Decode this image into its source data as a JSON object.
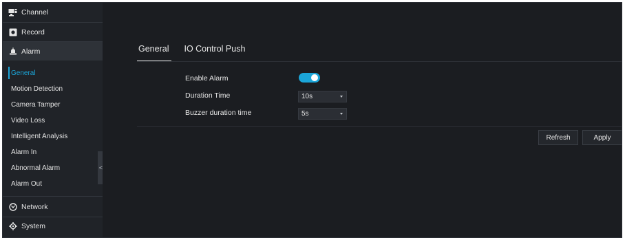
{
  "sidebar": {
    "top_items": [
      {
        "label": "Channel",
        "icon": "channel-icon"
      },
      {
        "label": "Record",
        "icon": "record-icon"
      },
      {
        "label": "Alarm",
        "icon": "alarm-icon"
      }
    ],
    "alarm_sub_items": [
      {
        "label": "General"
      },
      {
        "label": "Motion Detection"
      },
      {
        "label": "Camera Tamper"
      },
      {
        "label": "Video Loss"
      },
      {
        "label": "Intelligent Analysis"
      },
      {
        "label": "Alarm In"
      },
      {
        "label": "Abnormal Alarm"
      },
      {
        "label": "Alarm Out"
      }
    ],
    "bottom_items": [
      {
        "label": "Network",
        "icon": "network-icon"
      },
      {
        "label": "System",
        "icon": "system-icon"
      }
    ],
    "collapse_glyph": "<"
  },
  "main": {
    "tabs": [
      {
        "label": "General"
      },
      {
        "label": "IO Control Push"
      }
    ],
    "form": {
      "enable_alarm_label": "Enable Alarm",
      "enable_alarm_on": true,
      "duration_time_label": "Duration Time",
      "duration_time_value": "10s",
      "buzzer_label": "Buzzer duration time",
      "buzzer_value": "5s"
    },
    "buttons": {
      "refresh": "Refresh",
      "apply": "Apply"
    }
  },
  "colors": {
    "accent": "#1ba5d8",
    "background": "#1b1d21",
    "sidebar": "#202328"
  }
}
